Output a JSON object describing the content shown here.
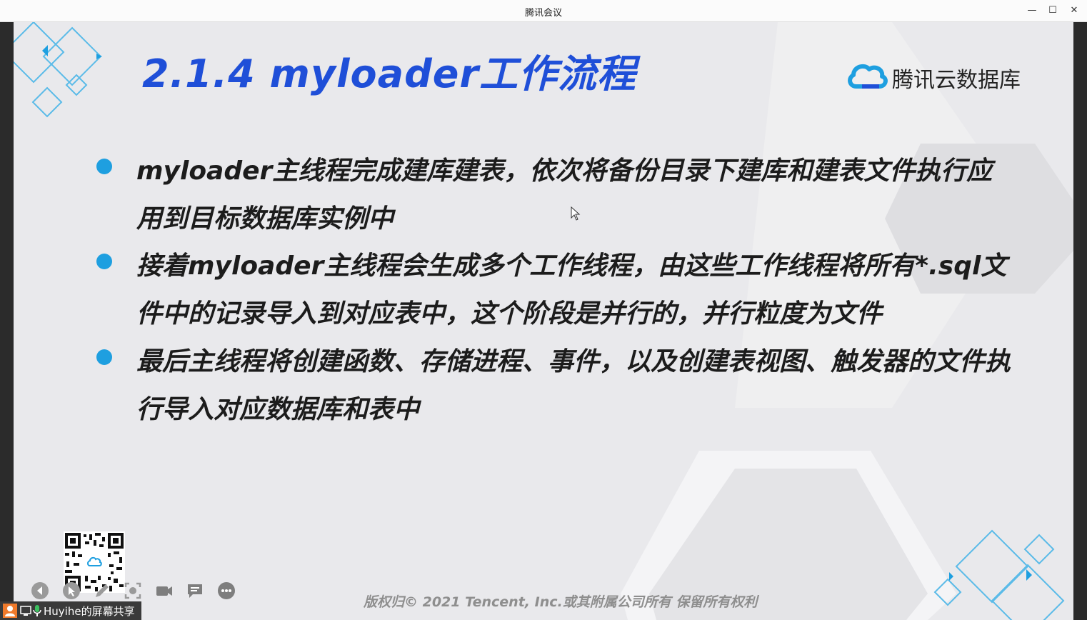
{
  "window": {
    "title": "腾讯会议",
    "controls": [
      "—",
      "☐",
      "✕"
    ]
  },
  "slide": {
    "title": "2.1.4 myloader工作流程",
    "brand_name": "腾讯云数据库",
    "bullets": [
      "myloader主线程完成建库建表，依次将备份目录下建库和建表文件执行应用到目标数据库实例中",
      "接着myloader主线程会生成多个工作线程，由这些工作线程将所有*.sql文件中的记录导入到对应表中，这个阶段是并行的，并行粒度为文件",
      "最后主线程将创建函数、存储进程、事件，以及创建表视图、触发器的文件执行导入对应数据库和表中"
    ],
    "footer": "版权归© 2021 Tencent, Inc.或其附属公司所有 保留所有权利"
  },
  "share": {
    "label": "Huyihe的屏幕共享"
  },
  "colors": {
    "accent": "#1f4fd8",
    "bullet": "#1e9fe0"
  },
  "icons": [
    "back-icon",
    "pointer-icon",
    "pen-icon",
    "screenshot-icon",
    "camera-icon",
    "chat-icon",
    "more-icon",
    "user-icon",
    "screen-icon",
    "mic-icon",
    "cloud-logo-icon",
    "qr-code"
  ]
}
